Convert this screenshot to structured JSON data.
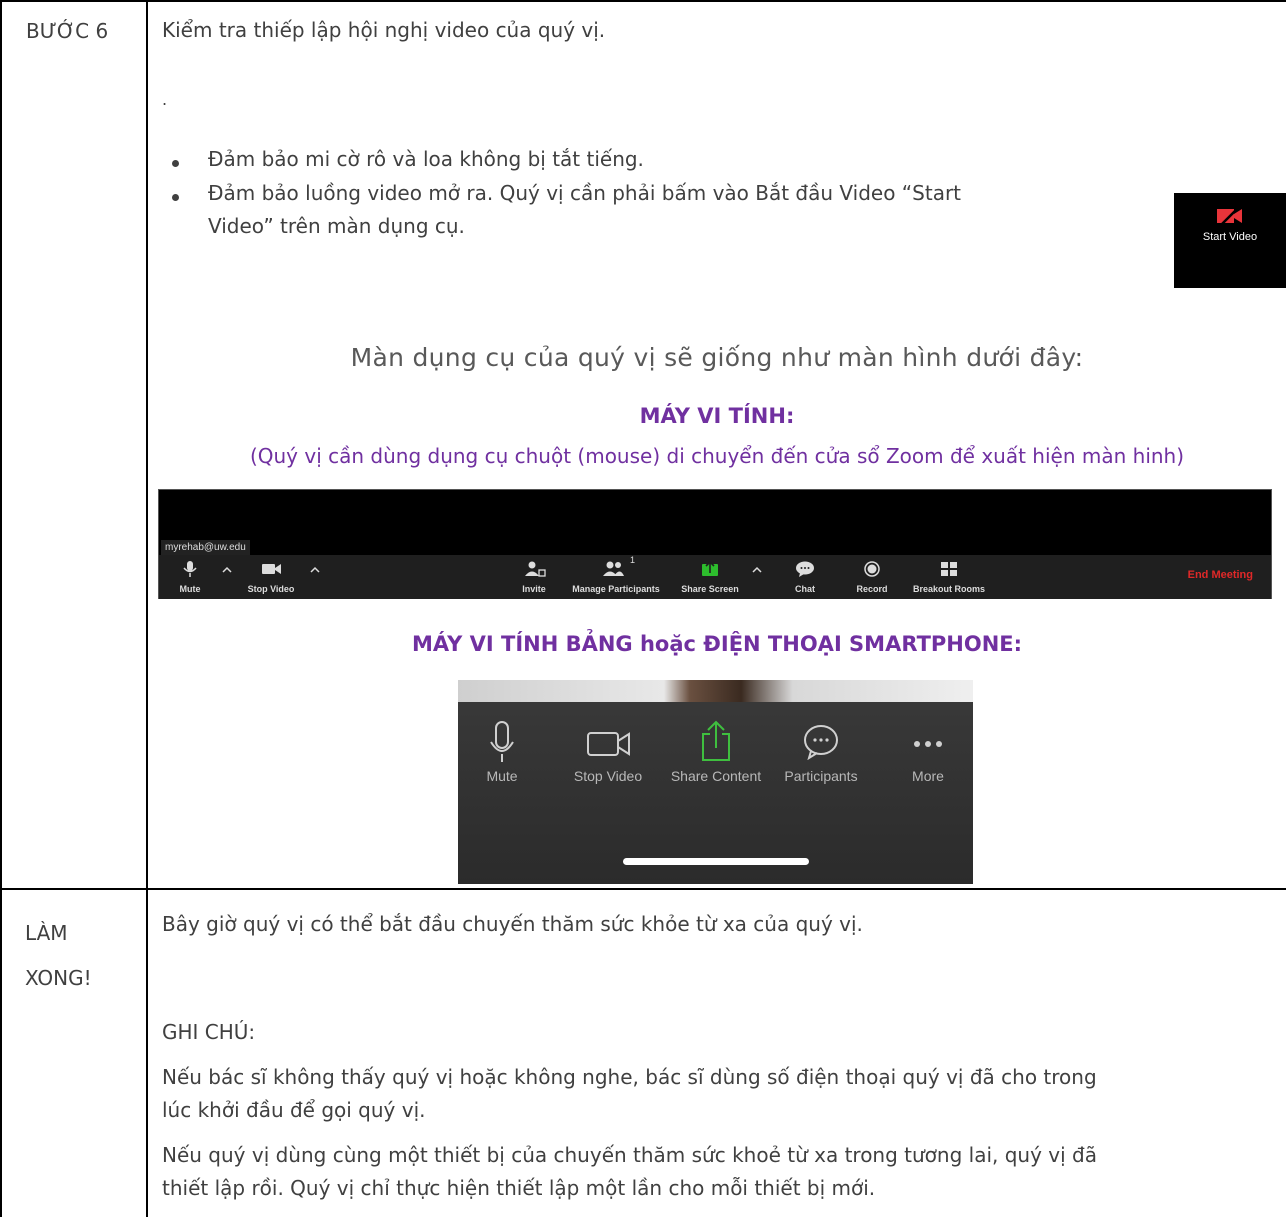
{
  "step6": {
    "label": "BƯỚC 6",
    "intro": "Kiểm tra thiếp lập hội nghị video của quý vị.",
    "dot": ".",
    "bullets": [
      "Đảm bảo mi cờ rô và loa không bị tắt tiếng.",
      "Đảm bảo luồng video mở ra. Quý vị cần phải bấm vào Bắt đầu Video “Start",
      "Video” trên màn dụng cụ."
    ],
    "start_video_label": "Start Video",
    "toolbar_heading": "Màn dụng cụ của quý vị sẽ giống như màn hình dưới đây:",
    "computer_heading": "MÁY VI TÍNH:",
    "computer_note": "(Quý vị cần dùng dụng cụ chuột (mouse) di chuyển đến cửa sổ Zoom để xuất hiện màn hinh)",
    "desktop_toolbar": {
      "email": "myrehab@uw.edu",
      "buttons": {
        "mute": "Mute",
        "stop_video": "Stop Video",
        "invite": "Invite",
        "manage_participants": "Manage Participants",
        "participant_count": "1",
        "share_screen": "Share Screen",
        "chat": "Chat",
        "record": "Record",
        "breakout_rooms": "Breakout Rooms",
        "end_meeting": "End Meeting"
      }
    },
    "mobile_heading": "MÁY VI TÍNH BẢNG hoặc ĐIỆN THOẠI SMARTPHONE:",
    "mobile_toolbar": {
      "mute": "Mute",
      "stop_video": "Stop Video",
      "share_content": "Share Content",
      "participants": "Participants",
      "more": "More"
    }
  },
  "done": {
    "label_line1": "LÀM",
    "label_line2": "XONG!",
    "line1": "Bây giờ quý vị có thể bắt đầu chuyến thăm sức khỏe từ xa của quý vị.",
    "note_heading": "GHI CHÚ:",
    "para1_line1": "Nếu bác sĩ không thấy quý vị hoặc không nghe, bác sĩ dùng số điện thoại quý vị đã cho trong",
    "para1_line2": "lúc khởi đầu để gọi quý vị.",
    "para2_line1": "Nếu quý vị dùng cùng một thiết bị của chuyến thăm sức khoẻ từ xa trong tương lai, quý vị đã",
    "para2_line2": "thiết lập rồi. Quý vị chỉ thực hiện thiết lập một lần cho mỗi thiết bị mới."
  },
  "colors": {
    "purple": "#7030a0",
    "end_meeting": "#e02828",
    "share_green": "#2dbd2d"
  }
}
